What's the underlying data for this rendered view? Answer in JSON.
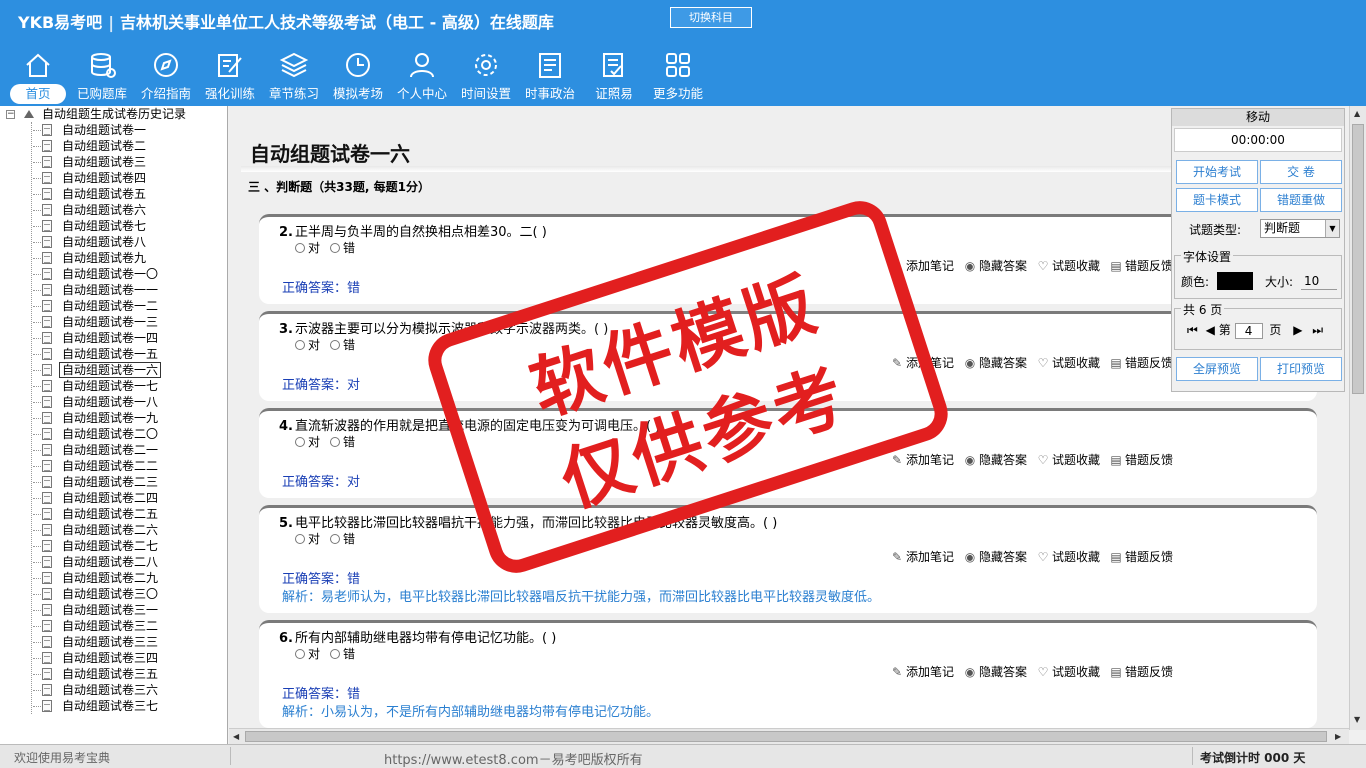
{
  "header": {
    "logo": "YKB易考吧",
    "title": "吉林机关事业单位工人技术等级考试（电工 - 高级）在线题库",
    "switch_label": "切换科目"
  },
  "nav": [
    {
      "label": "首页",
      "icon": "home-icon"
    },
    {
      "label": "已购题库",
      "icon": "database-icon"
    },
    {
      "label": "介绍指南",
      "icon": "compass-icon"
    },
    {
      "label": "强化训练",
      "icon": "edit-icon"
    },
    {
      "label": "章节练习",
      "icon": "layers-icon"
    },
    {
      "label": "模拟考场",
      "icon": "clock-icon"
    },
    {
      "label": "个人中心",
      "icon": "user-icon"
    },
    {
      "label": "时间设置",
      "icon": "gear-icon"
    },
    {
      "label": "时事政治",
      "icon": "news-icon"
    },
    {
      "label": "证照易",
      "icon": "certificate-icon"
    },
    {
      "label": "更多功能",
      "icon": "grid-icon"
    }
  ],
  "tree": {
    "root": "自动组题生成试卷历史记录",
    "items": [
      "自动组题试卷一",
      "自动组题试卷二",
      "自动组题试卷三",
      "自动组题试卷四",
      "自动组题试卷五",
      "自动组题试卷六",
      "自动组题试卷七",
      "自动组题试卷八",
      "自动组题试卷九",
      "自动组题试卷一〇",
      "自动组题试卷一一",
      "自动组题试卷一二",
      "自动组题试卷一三",
      "自动组题试卷一四",
      "自动组题试卷一五",
      "自动组题试卷一六",
      "自动组题试卷一七",
      "自动组题试卷一八",
      "自动组题试卷一九",
      "自动组题试卷二〇",
      "自动组题试卷二一",
      "自动组题试卷二二",
      "自动组题试卷二三",
      "自动组题试卷二四",
      "自动组题试卷二五",
      "自动组题试卷二六",
      "自动组题试卷二七",
      "自动组题试卷二八",
      "自动组题试卷二九",
      "自动组题试卷三〇",
      "自动组题试卷三一",
      "自动组题试卷三二",
      "自动组题试卷三三",
      "自动组题试卷三四",
      "自动组题试卷三五",
      "自动组题试卷三六",
      "自动组题试卷三七"
    ],
    "selected_index": 15
  },
  "main": {
    "paper_title": "自动组题试卷一六",
    "section": "三 、判断题（共33题, 每题1分）",
    "option_true": "对",
    "option_false": "错",
    "tools": {
      "note": "添加笔记",
      "hide": "隐藏答案",
      "fav": "试题收藏",
      "report": "错题反馈"
    },
    "questions": [
      {
        "num": "2.",
        "text": "正半周与负半周的自然换相点相差30。二( )",
        "answer": "正确答案：错",
        "analysis": ""
      },
      {
        "num": "3.",
        "text": "示波器主要可以分为模拟示波器和数字示波器两类。( )",
        "answer": "正确答案：对",
        "analysis": ""
      },
      {
        "num": "4.",
        "text": "直流斩波器的作用就是把直流电源的固定电压变为可调电压。( )",
        "answer": "正确答案：对",
        "analysis": ""
      },
      {
        "num": "5.",
        "text": "电平比较器比滞回比较器唱抗干扰能力强，而滞回比较器比电平比较器灵敏度高。( )",
        "answer": "正确答案：错",
        "analysis": "解析：易老师认为，电平比较器比滞回比较器唱反抗干扰能力强，而滞回比较器比电平比较器灵敏度低。"
      },
      {
        "num": "6.",
        "text": "所有内部辅助继电器均带有停电记忆功能。( )",
        "answer": "正确答案：错",
        "analysis": "解析：小易认为，不是所有内部辅助继电器均带有停电记忆功能。"
      }
    ]
  },
  "panel": {
    "head": "移动",
    "timer": "00:00:00",
    "start": "开始考试",
    "submit": "交  卷",
    "card_mode": "题卡模式",
    "redo": "错题重做",
    "qtype_label": "试题类型:",
    "qtype_value": "判断题",
    "font_legend": "字体设置",
    "color_label": "颜色:",
    "size_label": "大小:",
    "size_value": "10",
    "pages_legend": "共 6 页",
    "page_prefix": "第",
    "page_value": "4",
    "page_suffix": "页",
    "fullscreen": "全屏预览",
    "print": "打印预览"
  },
  "status": {
    "welcome": "欢迎使用易考宝典",
    "url": "https://www.etest8.com－易考吧版权所有",
    "countdown": "考试倒计时 000 天"
  },
  "watermark": {
    "line1": "软件模版",
    "line2": "仅供参考"
  },
  "colors": {
    "header_bg": "#2d8fe0",
    "answer": "#1a3fb5",
    "analysis": "#2a7fd0",
    "stamp": "#e21f1f"
  }
}
